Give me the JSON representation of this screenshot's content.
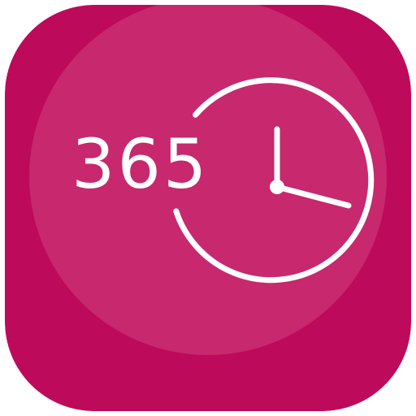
{
  "app_icon": {
    "number_text": "365",
    "clock_icon": "clock-icon",
    "colors": {
      "background": "#be0a5a",
      "inner_circle": "#c7286e",
      "foreground": "#ffffff"
    }
  }
}
